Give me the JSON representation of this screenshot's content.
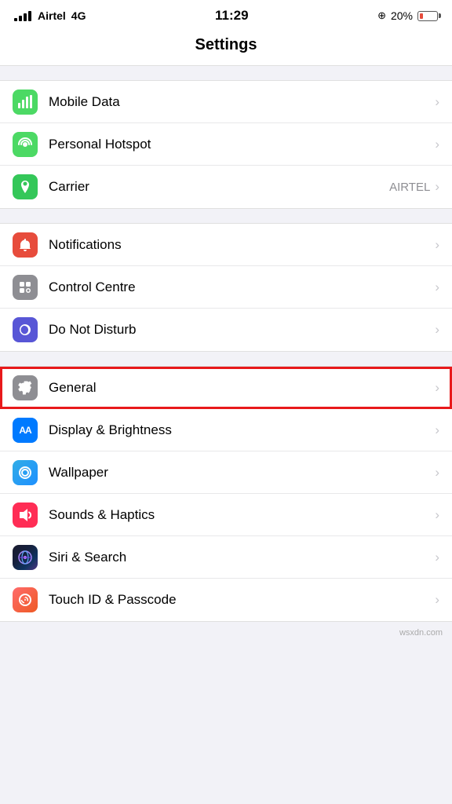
{
  "statusBar": {
    "carrier": "Airtel",
    "networkType": "4G",
    "time": "11:29",
    "batteryPercent": "20%",
    "batteryLevel": 20
  },
  "pageTitle": "Settings",
  "groups": [
    {
      "id": "network",
      "rows": [
        {
          "id": "mobile-data",
          "label": "Mobile Data",
          "value": "",
          "iconBg": "icon-green",
          "iconSymbol": "📶",
          "chevron": true
        },
        {
          "id": "personal-hotspot",
          "label": "Personal Hotspot",
          "value": "",
          "iconBg": "icon-green",
          "iconSymbol": "🔗",
          "chevron": true
        },
        {
          "id": "carrier",
          "label": "Carrier",
          "value": "AIRTEL",
          "iconBg": "icon-green2",
          "iconSymbol": "📞",
          "chevron": true
        }
      ]
    },
    {
      "id": "system1",
      "rows": [
        {
          "id": "notifications",
          "label": "Notifications",
          "value": "",
          "iconBg": "icon-red",
          "iconSymbol": "🔔",
          "chevron": true
        },
        {
          "id": "control-centre",
          "label": "Control Centre",
          "value": "",
          "iconBg": "icon-gray",
          "iconSymbol": "⊞",
          "chevron": true
        },
        {
          "id": "do-not-disturb",
          "label": "Do Not Disturb",
          "value": "",
          "iconBg": "icon-purple",
          "iconSymbol": "🌙",
          "chevron": true
        }
      ]
    },
    {
      "id": "system2",
      "rows": [
        {
          "id": "general",
          "label": "General",
          "value": "",
          "iconBg": "icon-gray",
          "iconSymbol": "⚙️",
          "chevron": true,
          "highlighted": true
        },
        {
          "id": "display-brightness",
          "label": "Display & Brightness",
          "value": "",
          "iconBg": "icon-blue",
          "iconSymbol": "AA",
          "iconText": true,
          "chevron": true
        },
        {
          "id": "wallpaper",
          "label": "Wallpaper",
          "value": "",
          "iconBg": "icon-lightblue",
          "iconSymbol": "❋",
          "chevron": true
        },
        {
          "id": "sounds-haptics",
          "label": "Sounds & Haptics",
          "value": "",
          "iconBg": "icon-pink",
          "iconSymbol": "🔊",
          "chevron": true
        },
        {
          "id": "siri-search",
          "label": "Siri & Search",
          "value": "",
          "iconBg": "icon-gradient-siri",
          "iconSymbol": "◉",
          "chevron": true
        },
        {
          "id": "touch-id-passcode",
          "label": "Touch ID & Passcode",
          "value": "",
          "iconBg": "icon-gradient-touch",
          "iconSymbol": "👆",
          "chevron": true
        }
      ]
    }
  ],
  "watermark": "wsxdn.com"
}
